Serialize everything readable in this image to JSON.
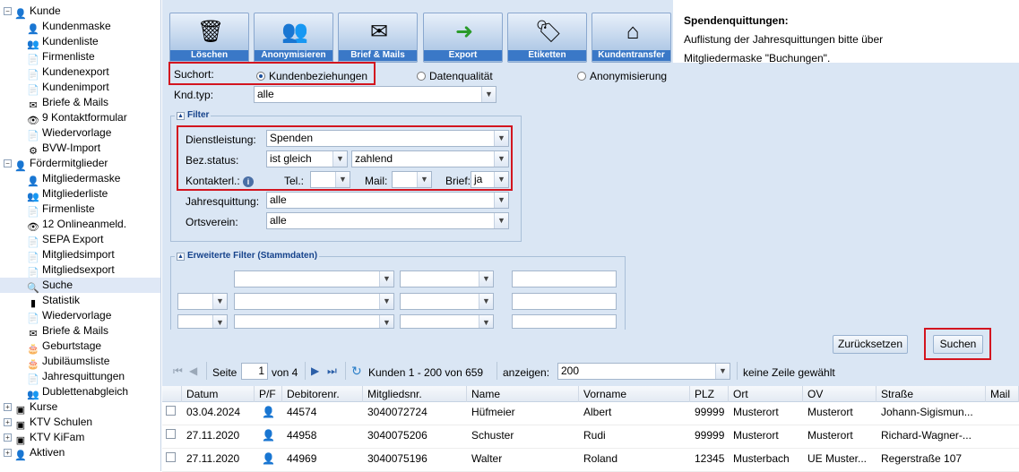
{
  "sidebar": {
    "items": [
      {
        "label": "Kunde",
        "icon": "person-icon",
        "level": 0,
        "expander": "minus"
      },
      {
        "label": "Kundenmaske",
        "icon": "person-icon",
        "level": 1
      },
      {
        "label": "Kundenliste",
        "icon": "people-icon",
        "level": 1
      },
      {
        "label": "Firmenliste",
        "icon": "document-icon",
        "level": 1
      },
      {
        "label": "Kundenexport",
        "icon": "document-icon",
        "level": 1
      },
      {
        "label": "Kundenimport",
        "icon": "document-icon",
        "level": 1
      },
      {
        "label": "Briefe & Mails",
        "icon": "envelope-icon",
        "level": 1
      },
      {
        "label": "9  Kontaktformular",
        "icon": "eye-icon",
        "level": 1
      },
      {
        "label": "Wiedervorlage",
        "icon": "document-icon",
        "level": 1
      },
      {
        "label": "BVW-Import",
        "icon": "gear-icon",
        "level": 1
      },
      {
        "label": "Fördermitglieder",
        "icon": "person-icon",
        "level": 0,
        "expander": "minus"
      },
      {
        "label": "Mitgliedermaske",
        "icon": "person-icon",
        "level": 1
      },
      {
        "label": "Mitgliederliste",
        "icon": "people-icon",
        "level": 1
      },
      {
        "label": "Firmenliste",
        "icon": "document-icon",
        "level": 1
      },
      {
        "label": "12  Onlineanmeld.",
        "icon": "eye-icon",
        "level": 1
      },
      {
        "label": "SEPA Export",
        "icon": "document-icon",
        "level": 1
      },
      {
        "label": "Mitgliedsimport",
        "icon": "document-icon",
        "level": 1
      },
      {
        "label": "Mitgliedsexport",
        "icon": "document-icon",
        "level": 1
      },
      {
        "label": "Suche",
        "icon": "search-icon",
        "level": 1,
        "selected": true
      },
      {
        "label": "Statistik",
        "icon": "chart-icon",
        "level": 1
      },
      {
        "label": "Wiedervorlage",
        "icon": "document-icon",
        "level": 1
      },
      {
        "label": "Briefe & Mails",
        "icon": "envelope-icon",
        "level": 1
      },
      {
        "label": "Geburtstage",
        "icon": "cake-icon",
        "level": 1
      },
      {
        "label": "Jubiläumsliste",
        "icon": "cake-icon",
        "level": 1
      },
      {
        "label": "Jahresquittungen",
        "icon": "document-icon",
        "level": 1
      },
      {
        "label": "Dublettenabgleich",
        "icon": "people-icon",
        "level": 1
      },
      {
        "label": "Kurse",
        "icon": "cube-icon",
        "level": 0,
        "expander": "plus"
      },
      {
        "label": "KTV Schulen",
        "icon": "cube-icon",
        "level": 0,
        "expander": "plus"
      },
      {
        "label": "KTV KiFam",
        "icon": "cube-icon",
        "level": 0,
        "expander": "plus"
      },
      {
        "label": "Aktiven",
        "icon": "person-icon",
        "level": 0,
        "expander": "plus"
      }
    ]
  },
  "toolbar": {
    "buttons": [
      {
        "label": "Löschen",
        "icon": "trash-icon"
      },
      {
        "label": "Anonymisieren",
        "icon": "anonymize-icon"
      },
      {
        "label": "Brief & Mails",
        "icon": "mail-icon"
      },
      {
        "label": "Export",
        "icon": "export-icon"
      },
      {
        "label": "Etiketten",
        "icon": "labels-icon"
      },
      {
        "label": "Kundentransfer",
        "icon": "transfer-icon"
      }
    ]
  },
  "info": {
    "title": "Spendenquittungen:",
    "line1": "Auflistung der Jahresquittungen bitte über",
    "line2": "Mitgliedermaske \"Buchungen\"."
  },
  "search": {
    "suchort_label": "Suchort:",
    "opt1": "Kundenbeziehungen",
    "opt2": "Datenqualität",
    "opt3": "Anonymisierung",
    "kndtyp_label": "Knd.typ:",
    "kndtyp_value": "alle"
  },
  "filter": {
    "legend": "Filter",
    "dienstleistung_label": "Dienstleistung:",
    "dienstleistung_value": "Spenden",
    "bezstatus_label": "Bez.status:",
    "bezstatus_op": "ist gleich",
    "bezstatus_value": "zahlend",
    "kontakterl_label": "Kontakterl.:",
    "tel_label": "Tel.:",
    "mail_label": "Mail:",
    "brief_label": "Brief:",
    "brief_value": "ja",
    "jahresquittung_label": "Jahresquittung:",
    "jahresquittung_value": "alle",
    "ortsverein_label": "Ortsverein:",
    "ortsverein_value": "alle"
  },
  "erweitert": {
    "legend": "Erweiterte Filter (Stammdaten)"
  },
  "actions": {
    "reset": "Zurücksetzen",
    "search": "Suchen"
  },
  "pager": {
    "page_label": "Seite",
    "page_value": "1",
    "of_pages": "von 4",
    "range": "Kunden 1 - 200 von 659",
    "show_label": "anzeigen:",
    "show_value": "200",
    "selection": "keine Zeile gewählt"
  },
  "grid": {
    "columns": [
      "Datum",
      "P/F",
      "Debitorenr.",
      "Mitgliedsnr.",
      "Name",
      "Vorname",
      "PLZ",
      "Ort",
      "OV",
      "Straße",
      "Mail"
    ],
    "rows": [
      [
        "03.04.2024",
        "",
        "44574",
        "3040072724",
        "Hüfmeier",
        "Albert",
        "99999",
        "Musterort",
        "Musterort",
        "Johann-Sigismun...",
        ""
      ],
      [
        "27.11.2020",
        "",
        "44958",
        "3040075206",
        "Schuster",
        "Rudi",
        "99999",
        "Musterort",
        "Musterort",
        "Richard-Wagner-...",
        ""
      ],
      [
        "27.11.2020",
        "",
        "44969",
        "3040075196",
        "Walter",
        "Roland",
        "12345",
        "Musterbach",
        "UE Muster...",
        "Regerstraße 107",
        ""
      ]
    ]
  }
}
